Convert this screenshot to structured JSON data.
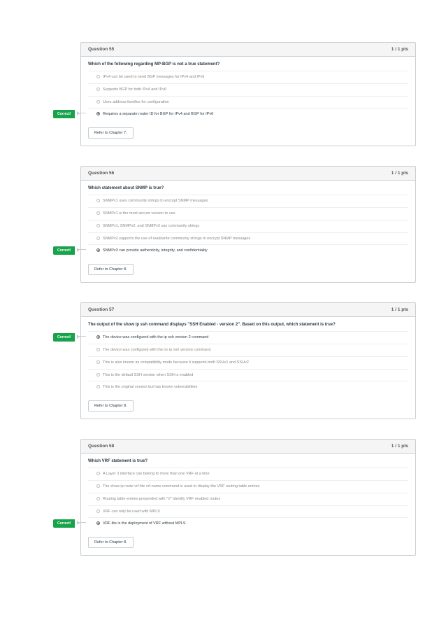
{
  "labels": {
    "correct": "Correct!"
  },
  "questions": [
    {
      "title": "Question 55",
      "pts": "1 / 1 pts",
      "prompt": "Which of the following regarding MP-BGP is not a true statement?",
      "options": [
        {
          "text": "IPv4 can be used to send BGP messages for IPv4 and IPv6",
          "selected": false
        },
        {
          "text": "Supports BGP for both IPv4 and IPv6",
          "selected": false
        },
        {
          "text": "Uses address families for configuration",
          "selected": false
        },
        {
          "text": "Requires a separate router ID for BGP for IPv4 and BGP for IPv6",
          "selected": true
        }
      ],
      "refer": "Refer to Chapter 7."
    },
    {
      "title": "Question 56",
      "pts": "1 / 1 pts",
      "prompt": "Which statement about SNMP is true?",
      "options": [
        {
          "text": "SNMPv1 uses community strings to encrypt SNMP messages",
          "selected": false
        },
        {
          "text": "SNMPv1 is the most secure version to use",
          "selected": false
        },
        {
          "text": "SNMPv1, SNMPv2, and SNMPv3 use community strings",
          "selected": false
        },
        {
          "text": "SNMPv2 supports the use of read/write community strings to encrypt SNMP messages",
          "selected": false
        },
        {
          "text": "SNMPv3 can provide authenticity, integrity, and confidentiality",
          "selected": true
        }
      ],
      "refer": "Refer to Chapter 8."
    },
    {
      "title": "Question 57",
      "pts": "1 / 1 pts",
      "prompt": "The output of the show ip ssh command displays \"SSH Enabled - version 2\". Based on this output, which statement is true?",
      "options": [
        {
          "text": "The device was configured with the ip ssh version 2 command",
          "selected": true
        },
        {
          "text": "The device was configured with the no ip ssh version command",
          "selected": false
        },
        {
          "text": "This is also known as compatibility mode because it supports both SSHv1 and SSHv2",
          "selected": false
        },
        {
          "text": "This is the default SSH version when SSH is enabled",
          "selected": false
        },
        {
          "text": "This is the original version but has known vulnerabilities",
          "selected": false
        }
      ],
      "refer": "Refer to Chapter 8."
    },
    {
      "title": "Question 58",
      "pts": "1 / 1 pts",
      "prompt": "Which VRF statement is true?",
      "options": [
        {
          "text": "A Layer 3 interface can belong to more than one VRF at a time",
          "selected": false
        },
        {
          "text": "The show ip route vrf-lite vrf-name command is used to display the VRF routing table entries",
          "selected": false
        },
        {
          "text": "Routing table entries prepended with \"V\" identify VRF enabled routes",
          "selected": false
        },
        {
          "text": "VRF can only be used with MPLS",
          "selected": false
        },
        {
          "text": "VRF-lite is the deployment of VRF without MPLS",
          "selected": true
        }
      ],
      "refer": "Refer to Chapter 8."
    }
  ]
}
